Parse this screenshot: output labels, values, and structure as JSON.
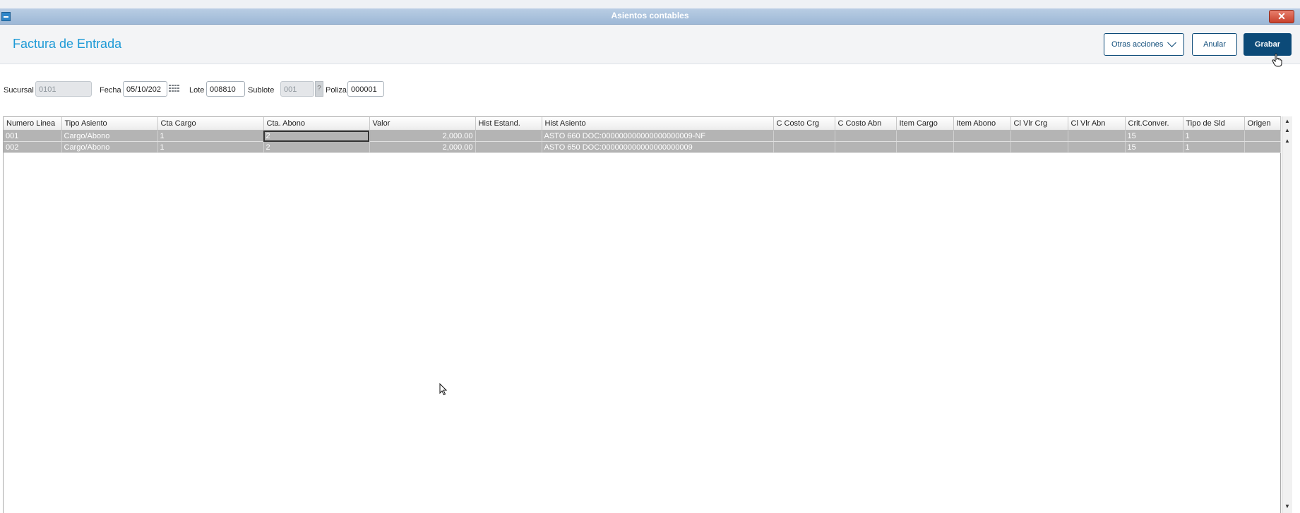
{
  "window": {
    "title": "Asientos contables",
    "close_symbol": "✕"
  },
  "header": {
    "title": "Factura de Entrada",
    "buttons": {
      "otras_acciones": "Otras acciones",
      "anular": "Anular",
      "grabar": "Grabar"
    }
  },
  "fields": {
    "sucursal": {
      "label": "Sucursal",
      "value": "0101"
    },
    "fecha": {
      "label": "Fecha",
      "value": "05/10/202"
    },
    "lote": {
      "label": "Lote",
      "value": "008810"
    },
    "sublote": {
      "label": "Sublote",
      "value": "001",
      "lookup": "?"
    },
    "poliza": {
      "label": "Poliza",
      "value": "000001"
    }
  },
  "grid": {
    "columns": [
      "Numero Linea",
      "Tipo Asiento",
      "Cta Cargo",
      "Cta. Abono",
      "Valor",
      "Hist Estand.",
      "Hist Asiento",
      "C Costo Crg",
      "C Costo Abn",
      "Item Cargo",
      "Item Abono",
      "Cl Vlr Crg",
      "Cl Vlr Abn",
      "Crit.Conver.",
      "Tipo de Sld",
      "Origen"
    ],
    "rows": [
      [
        "001",
        "Cargo/Abono",
        "1",
        "2",
        "2,000.00",
        "",
        "ASTO 660 DOC:000000000000000000009-NF",
        "",
        "",
        "",
        "",
        "",
        "",
        "15",
        "1",
        ""
      ],
      [
        "002",
        "Cargo/Abono",
        "1",
        "2",
        "2,000.00",
        "",
        "ASTO 650 DOC:000000000000000000009",
        "",
        "",
        "",
        "",
        "",
        "",
        "15",
        "1",
        ""
      ]
    ]
  },
  "icons": {
    "window": "window-icon",
    "calendar": "calendar-icon",
    "chevron": "chevron-down-icon"
  },
  "colors": {
    "accent": "#1e9ad6",
    "primary": "#0c4a78",
    "titlebar": "#9db8d6",
    "selected_row": "#b4b4b4"
  }
}
